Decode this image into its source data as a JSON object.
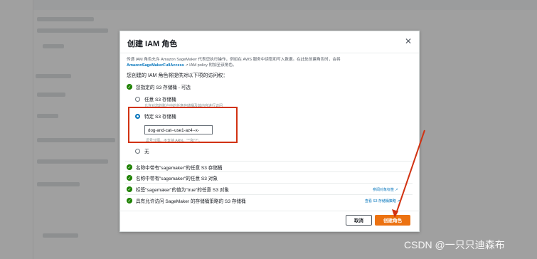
{
  "modal": {
    "title": "创建 IAM 角色",
    "close_icon": "close-icon",
    "description_1": "传递 IAM 角色允许 Amazon SageMaker 代表您执行操作，例如在 AWS 服务中读取和写入数据。在此处创建角色时，会将",
    "description_policy": "AmazonSageMakerFullAccess",
    "description_2": "IAM policy 附加至该角色。",
    "lead": "您创建的 IAM 角色将提供对以下项的访问权：",
    "s3_heading": "您指定的 S3 存储桶 - 可选",
    "option_any": "任意 S3 存储桶",
    "option_any_sub": "允许对您的账户中的任意存储桶及其内容进行访问",
    "option_specific": "特定 S3 存储桶",
    "bucket_value": "dog-and-cat--use1-az4--x-",
    "bucket_hint": "逗号分隔。不支持 ARN。\"*\"和\"?\"。",
    "option_none": "无",
    "perm_1": "名称中带有\"sagemaker\"的任意 S3 存储桶",
    "perm_2": "名称中带有\"sagemaker\"的任意 S3 对象",
    "perm_3": "标签\"sagemaker\"的值为\"true\"的任意 S3 对象",
    "perm_3_link": "参阅对象标签",
    "perm_4": "具有允许访问 SageMaker 的存储桶策略的 S3 存储桶",
    "perm_4_link": "查看 S3 存储桶策略",
    "cancel_label": "取消",
    "create_label": "创建角色"
  },
  "watermark": "CSDN @一只只迪森布"
}
